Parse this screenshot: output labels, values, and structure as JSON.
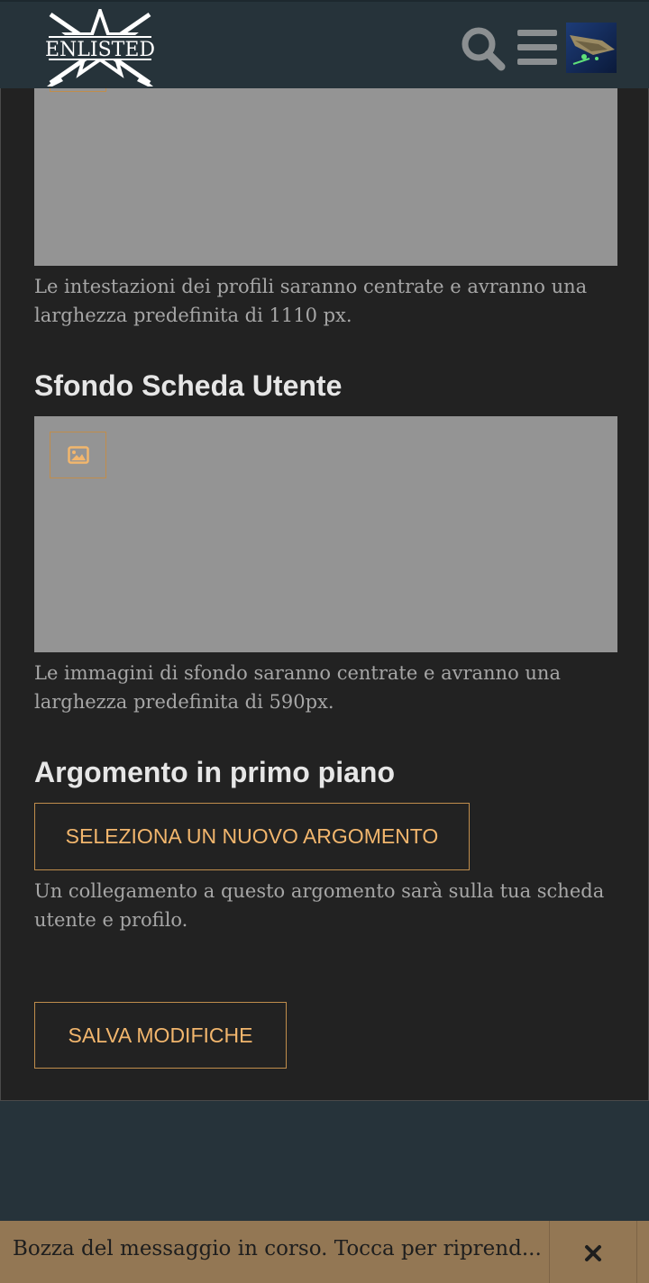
{
  "header": {
    "logo_text": "ENLISTED",
    "search_icon": "search-icon",
    "menu_icon": "hamburger-menu-icon",
    "avatar_icon": "user-avatar"
  },
  "profile_header": {
    "help_text": "Le intestazioni dei profili saranno centrate e avranno una larghezza predefinita di 1110 px."
  },
  "user_card_background": {
    "title": "Sfondo Scheda Utente",
    "upload_icon": "image-icon",
    "help_text": "Le immagini di sfondo saranno centrate e avranno una larghezza predefinita di 590px."
  },
  "featured_topic": {
    "title": "Argomento in primo piano",
    "select_button": "SELEZIONA UN NUOVO ARGOMENTO",
    "help_text": "Un collegamento a questo argomento sarà sulla tua scheda utente e profilo."
  },
  "save_button": "SALVA MODIFICHE",
  "draft_bar": {
    "text": "Bozza del messaggio in corso. Tocca per riprend...",
    "close_icon": "close-icon"
  },
  "colors": {
    "accent": "#f2b66d",
    "border_accent": "#c08d4c",
    "content_bg": "#222222",
    "header_bg": "#26333a",
    "draft_bg": "#937754"
  }
}
